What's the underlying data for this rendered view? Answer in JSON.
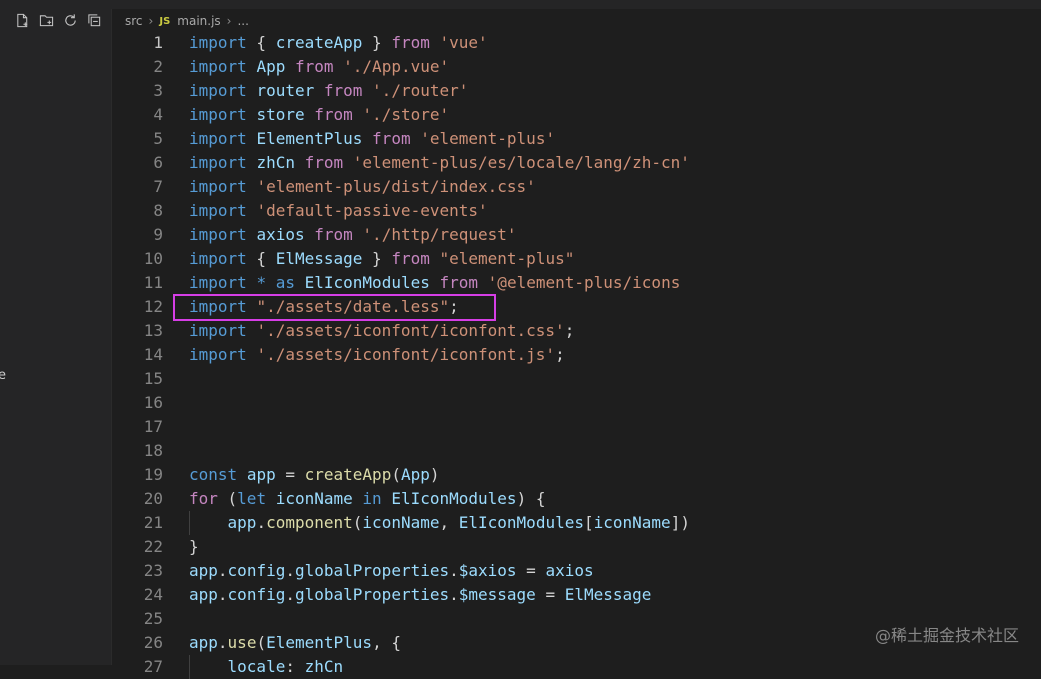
{
  "sidebar": {
    "actions": [
      "new-file-icon",
      "new-folder-icon",
      "refresh-icon",
      "collapse-all-icon"
    ],
    "edge_char": "e"
  },
  "breadcrumb": {
    "folder": "src",
    "file_badge": "JS",
    "file": "main.js",
    "ellipsis": "..."
  },
  "editor": {
    "lines": [
      {
        "n": "1",
        "t": [
          [
            "kw",
            "import"
          ],
          [
            "pl",
            " { "
          ],
          [
            "id",
            "createApp"
          ],
          [
            "pl",
            " } "
          ],
          [
            "ctl",
            "from"
          ],
          [
            "pl",
            " "
          ],
          [
            "str",
            "'vue'"
          ]
        ]
      },
      {
        "n": "2",
        "t": [
          [
            "kw",
            "import"
          ],
          [
            "pl",
            " "
          ],
          [
            "id",
            "App"
          ],
          [
            "pl",
            " "
          ],
          [
            "ctl",
            "from"
          ],
          [
            "pl",
            " "
          ],
          [
            "str",
            "'./App.vue'"
          ]
        ]
      },
      {
        "n": "3",
        "t": [
          [
            "kw",
            "import"
          ],
          [
            "pl",
            " "
          ],
          [
            "id",
            "router"
          ],
          [
            "pl",
            " "
          ],
          [
            "ctl",
            "from"
          ],
          [
            "pl",
            " "
          ],
          [
            "str",
            "'./router'"
          ]
        ]
      },
      {
        "n": "4",
        "t": [
          [
            "kw",
            "import"
          ],
          [
            "pl",
            " "
          ],
          [
            "id",
            "store"
          ],
          [
            "pl",
            " "
          ],
          [
            "ctl",
            "from"
          ],
          [
            "pl",
            " "
          ],
          [
            "str",
            "'./store'"
          ]
        ]
      },
      {
        "n": "5",
        "t": [
          [
            "kw",
            "import"
          ],
          [
            "pl",
            " "
          ],
          [
            "id",
            "ElementPlus"
          ],
          [
            "pl",
            " "
          ],
          [
            "ctl",
            "from"
          ],
          [
            "pl",
            " "
          ],
          [
            "str",
            "'element-plus'"
          ]
        ]
      },
      {
        "n": "6",
        "t": [
          [
            "kw",
            "import"
          ],
          [
            "pl",
            " "
          ],
          [
            "id",
            "zhCn"
          ],
          [
            "pl",
            " "
          ],
          [
            "ctl",
            "from"
          ],
          [
            "pl",
            " "
          ],
          [
            "str",
            "'element-plus/es/locale/lang/zh-cn'"
          ]
        ]
      },
      {
        "n": "7",
        "t": [
          [
            "kw",
            "import"
          ],
          [
            "pl",
            " "
          ],
          [
            "str",
            "'element-plus/dist/index.css'"
          ]
        ]
      },
      {
        "n": "8",
        "t": [
          [
            "kw",
            "import"
          ],
          [
            "pl",
            " "
          ],
          [
            "str",
            "'default-passive-events'"
          ]
        ]
      },
      {
        "n": "9",
        "t": [
          [
            "kw",
            "import"
          ],
          [
            "pl",
            " "
          ],
          [
            "id",
            "axios"
          ],
          [
            "pl",
            " "
          ],
          [
            "ctl",
            "from"
          ],
          [
            "pl",
            " "
          ],
          [
            "str",
            "'./http/request'"
          ]
        ]
      },
      {
        "n": "10",
        "t": [
          [
            "kw",
            "import"
          ],
          [
            "pl",
            " { "
          ],
          [
            "id",
            "ElMessage"
          ],
          [
            "pl",
            " } "
          ],
          [
            "ctl",
            "from"
          ],
          [
            "pl",
            " "
          ],
          [
            "str",
            "\"element-plus\""
          ]
        ]
      },
      {
        "n": "11",
        "t": [
          [
            "kw",
            "import"
          ],
          [
            "pl",
            " "
          ],
          [
            "kw",
            "*"
          ],
          [
            "pl",
            " "
          ],
          [
            "kw",
            "as"
          ],
          [
            "pl",
            " "
          ],
          [
            "id",
            "ElIconModules"
          ],
          [
            "pl",
            " "
          ],
          [
            "ctl",
            "from"
          ],
          [
            "pl",
            " "
          ],
          [
            "str",
            "'@element-plus/icons"
          ]
        ]
      },
      {
        "n": "12",
        "t": [
          [
            "kw",
            "import"
          ],
          [
            "pl",
            " "
          ],
          [
            "str",
            "\"./assets/date.less\""
          ],
          [
            "pl",
            ";"
          ]
        ]
      },
      {
        "n": "13",
        "t": [
          [
            "kw",
            "import"
          ],
          [
            "pl",
            " "
          ],
          [
            "str",
            "'./assets/iconfont/iconfont.css'"
          ],
          [
            "pl",
            ";"
          ]
        ]
      },
      {
        "n": "14",
        "t": [
          [
            "kw",
            "import"
          ],
          [
            "pl",
            " "
          ],
          [
            "str",
            "'./assets/iconfont/iconfont.js'"
          ],
          [
            "pl",
            ";"
          ]
        ]
      },
      {
        "n": "15",
        "t": []
      },
      {
        "n": "16",
        "t": []
      },
      {
        "n": "17",
        "t": []
      },
      {
        "n": "18",
        "t": []
      },
      {
        "n": "19",
        "t": [
          [
            "kw",
            "const"
          ],
          [
            "pl",
            " "
          ],
          [
            "id",
            "app"
          ],
          [
            "pl",
            " = "
          ],
          [
            "fn",
            "createApp"
          ],
          [
            "pl",
            "("
          ],
          [
            "id",
            "App"
          ],
          [
            "pl",
            ")"
          ]
        ]
      },
      {
        "n": "20",
        "t": [
          [
            "ctl",
            "for"
          ],
          [
            "pl",
            " ("
          ],
          [
            "kw",
            "let"
          ],
          [
            "pl",
            " "
          ],
          [
            "id",
            "iconName"
          ],
          [
            "pl",
            " "
          ],
          [
            "kw",
            "in"
          ],
          [
            "pl",
            " "
          ],
          [
            "id",
            "ElIconModules"
          ],
          [
            "pl",
            ") {"
          ]
        ]
      },
      {
        "n": "21",
        "t": [
          [
            "pl",
            "    "
          ],
          [
            "id",
            "app"
          ],
          [
            "pl",
            "."
          ],
          [
            "fn",
            "component"
          ],
          [
            "pl",
            "("
          ],
          [
            "id",
            "iconName"
          ],
          [
            "pl",
            ", "
          ],
          [
            "id",
            "ElIconModules"
          ],
          [
            "pl",
            "["
          ],
          [
            "id",
            "iconName"
          ],
          [
            "pl",
            "])"
          ]
        ]
      },
      {
        "n": "22",
        "t": [
          [
            "pl",
            "}"
          ]
        ]
      },
      {
        "n": "23",
        "t": [
          [
            "id",
            "app"
          ],
          [
            "pl",
            "."
          ],
          [
            "id",
            "config"
          ],
          [
            "pl",
            "."
          ],
          [
            "id",
            "globalProperties"
          ],
          [
            "pl",
            "."
          ],
          [
            "id",
            "$axios"
          ],
          [
            "pl",
            " = "
          ],
          [
            "id",
            "axios"
          ]
        ]
      },
      {
        "n": "24",
        "t": [
          [
            "id",
            "app"
          ],
          [
            "pl",
            "."
          ],
          [
            "id",
            "config"
          ],
          [
            "pl",
            "."
          ],
          [
            "id",
            "globalProperties"
          ],
          [
            "pl",
            "."
          ],
          [
            "id",
            "$message"
          ],
          [
            "pl",
            " = "
          ],
          [
            "id",
            "ElMessage"
          ]
        ]
      },
      {
        "n": "25",
        "t": []
      },
      {
        "n": "26",
        "t": [
          [
            "id",
            "app"
          ],
          [
            "pl",
            "."
          ],
          [
            "fn",
            "use"
          ],
          [
            "pl",
            "("
          ],
          [
            "id",
            "ElementPlus"
          ],
          [
            "pl",
            ", {"
          ]
        ]
      },
      {
        "n": "27",
        "t": [
          [
            "pl",
            "    "
          ],
          [
            "id",
            "locale"
          ],
          [
            "pl",
            ": "
          ],
          [
            "id",
            "zhCn"
          ]
        ]
      }
    ]
  },
  "watermark": "@稀土掘金技术社区"
}
